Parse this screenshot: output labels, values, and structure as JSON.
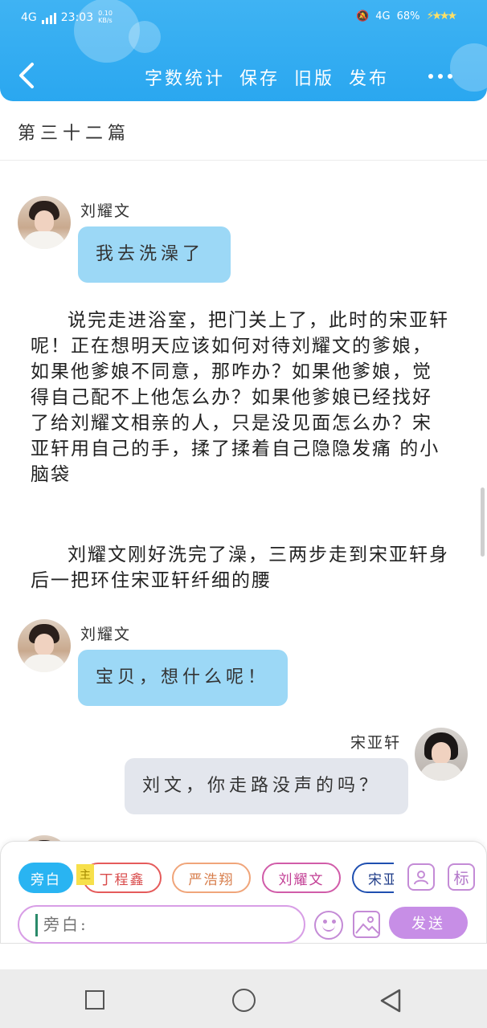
{
  "status_bar": {
    "network_left": "4G",
    "time": "23:03",
    "speed": "0.10 KB/s",
    "network_right": "4G",
    "battery": "68%"
  },
  "header": {
    "actions": [
      "字数统计",
      "保存",
      "旧版",
      "发布"
    ],
    "back_icon": "chevron-left-icon",
    "more_icon": "more-horizontal-icon"
  },
  "chapter_title": "第三十二篇",
  "messages": [
    {
      "type": "dialog",
      "side": "left",
      "speaker": "刘耀文",
      "text": "我去洗澡了"
    },
    {
      "type": "narration",
      "text": "说完走进浴室，把门关上了，此时的宋亚轩呢！正在想明天应该如何对待刘耀文的爹娘，如果他爹娘不同意，那咋办？如果他爹娘，觉得自己配不上他怎么办？如果他爹娘已经找好了给刘耀文相亲的人，只是没见面怎么办？宋亚轩用自己的手，揉了揉着自己隐隐发痛 的小脑袋"
    },
    {
      "type": "narration",
      "text": "刘耀文刚好洗完了澡，三两步走到宋亚轩身后一把环住宋亚轩纤细的腰"
    },
    {
      "type": "dialog",
      "side": "left",
      "speaker": "刘耀文",
      "text": "宝贝，想什么呢！"
    },
    {
      "type": "dialog",
      "side": "right",
      "speaker": "宋亚轩",
      "text": "刘文，你走路没声的吗？"
    }
  ],
  "input_panel": {
    "main_tag": "主",
    "roles": [
      "旁白",
      "丁程鑫",
      "严浩翔",
      "刘耀文",
      "宋亚"
    ],
    "input_placeholder": "旁白:",
    "send_label": "发送",
    "label_icon_text": "标",
    "icons": [
      "person-icon",
      "label-icon",
      "emoji-icon",
      "image-icon"
    ]
  },
  "colors": {
    "header_blue": "#2aa7f0",
    "bubble_left": "#9cd8f6",
    "bubble_right": "#e3e6ed",
    "send_purple": "#c78ee6",
    "narration_chip": "#29b4f2"
  }
}
